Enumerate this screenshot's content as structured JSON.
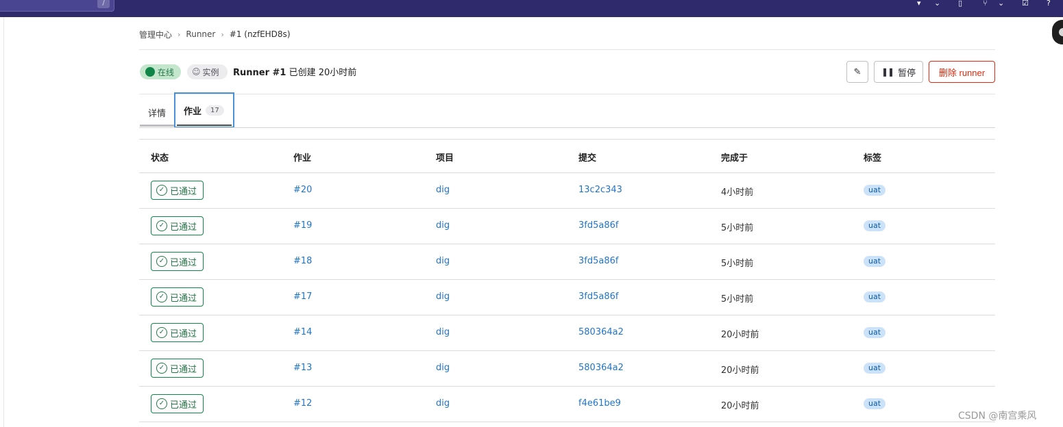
{
  "topbar": {
    "search_shortcut": "/"
  },
  "breadcrumb": {
    "items": [
      "管理中心",
      "Runner",
      "#1 (nzfEHD8s)"
    ]
  },
  "header": {
    "online_label": "在线",
    "instance_label": "实例",
    "runner_name": "Runner #1",
    "created_text": "已创建 20小时前",
    "pause_label": "暂停",
    "delete_label": "删除 runner"
  },
  "tabs": {
    "details": "详情",
    "jobs": "作业",
    "jobs_count": "17"
  },
  "table": {
    "columns": [
      "状态",
      "作业",
      "项目",
      "提交",
      "完成于",
      "标签"
    ],
    "rows": [
      {
        "status": "已通过",
        "job": "#20",
        "project": "dig",
        "commit": "13c2c343",
        "finished": "4小时前",
        "tag": "uat"
      },
      {
        "status": "已通过",
        "job": "#19",
        "project": "dig",
        "commit": "3fd5a86f",
        "finished": "5小时前",
        "tag": "uat"
      },
      {
        "status": "已通过",
        "job": "#18",
        "project": "dig",
        "commit": "3fd5a86f",
        "finished": "5小时前",
        "tag": "uat"
      },
      {
        "status": "已通过",
        "job": "#17",
        "project": "dig",
        "commit": "3fd5a86f",
        "finished": "5小时前",
        "tag": "uat"
      },
      {
        "status": "已通过",
        "job": "#14",
        "project": "dig",
        "commit": "580364a2",
        "finished": "20小时前",
        "tag": "uat"
      },
      {
        "status": "已通过",
        "job": "#13",
        "project": "dig",
        "commit": "580364a2",
        "finished": "20小时前",
        "tag": "uat"
      },
      {
        "status": "已通过",
        "job": "#12",
        "project": "dig",
        "commit": "f4e61be9",
        "finished": "20小时前",
        "tag": "uat"
      }
    ]
  },
  "watermark": "CSDN @南宫乘风",
  "colors": {
    "topbar": "#2f2a6b",
    "success": "#108548",
    "link": "#1f75cb",
    "danger": "#dd2b0e",
    "tag_bg": "#cbe2f9"
  }
}
